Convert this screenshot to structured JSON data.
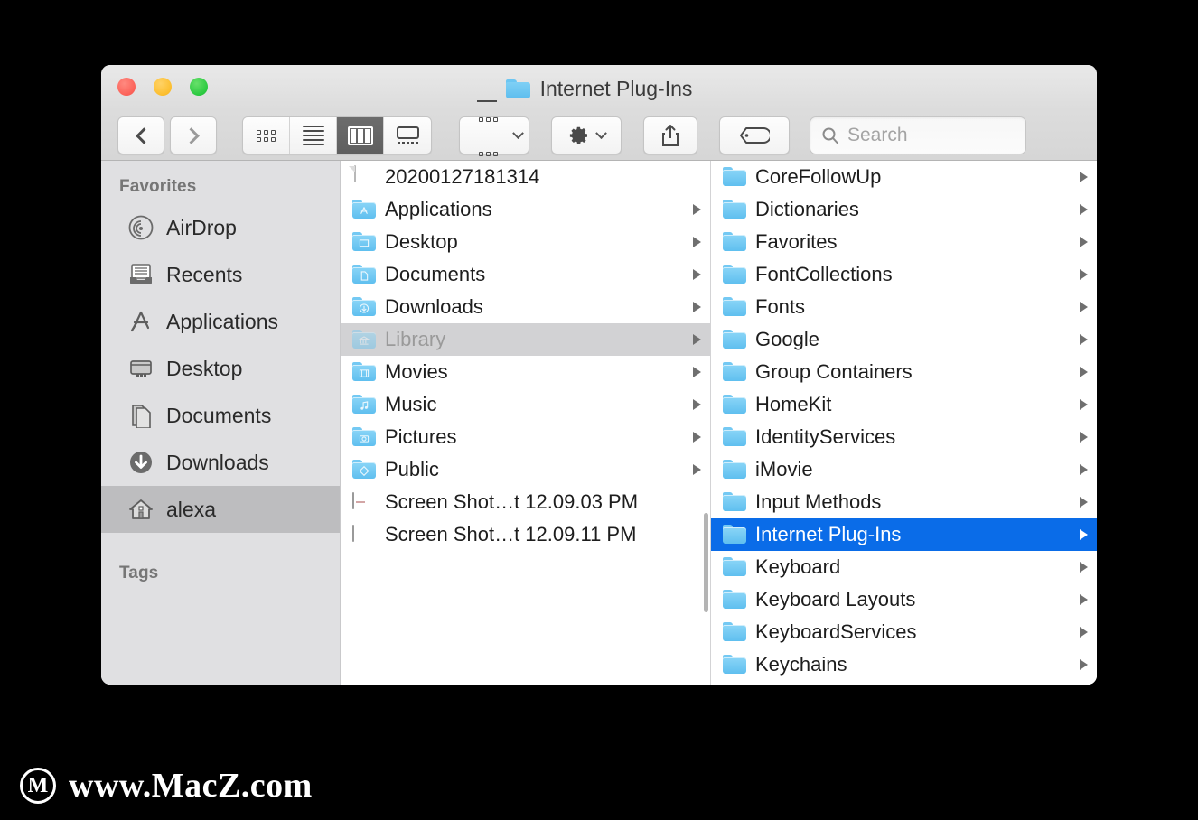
{
  "window": {
    "title": "Internet Plug-Ins",
    "title_icon": "folder-icon",
    "traffic_lights": [
      {
        "name": "close-button",
        "color": "#fb6158"
      },
      {
        "name": "minimize-button",
        "color": "#fcbe2e"
      },
      {
        "name": "maximize-button",
        "color": "#2bc940"
      }
    ]
  },
  "toolbar": {
    "back_label": "",
    "forward_label": "",
    "view_modes": [
      {
        "name": "icon-view",
        "icon": "grid-icon",
        "active": false
      },
      {
        "name": "list-view",
        "icon": "list-icon",
        "active": false
      },
      {
        "name": "column-view",
        "icon": "columns-icon",
        "active": true
      },
      {
        "name": "gallery-view",
        "icon": "coverflow-icon",
        "active": false
      }
    ],
    "arrange_label": "",
    "action_label": "",
    "share_label": "",
    "tags_label": ""
  },
  "search": {
    "placeholder": "Search",
    "value": "",
    "icon": "search-icon"
  },
  "sidebar": {
    "sections": [
      {
        "header": "Favorites",
        "items": [
          {
            "label": "AirDrop",
            "icon": "airdrop-icon",
            "selected": false
          },
          {
            "label": "Recents",
            "icon": "recents-icon",
            "selected": false
          },
          {
            "label": "Applications",
            "icon": "applications-icon",
            "selected": false
          },
          {
            "label": "Desktop",
            "icon": "desktop-icon",
            "selected": false
          },
          {
            "label": "Documents",
            "icon": "documents-icon",
            "selected": false
          },
          {
            "label": "Downloads",
            "icon": "downloads-icon",
            "selected": false
          },
          {
            "label": "alexa",
            "icon": "home-icon",
            "selected": true
          }
        ]
      },
      {
        "header": "Tags",
        "items": []
      }
    ]
  },
  "columns": [
    {
      "name": "column-home",
      "rows": [
        {
          "label": "20200127181314",
          "icon": "file-icon",
          "arrow": false,
          "state": "normal"
        },
        {
          "label": "Applications",
          "icon": "folder-apps-icon",
          "arrow": true,
          "state": "normal"
        },
        {
          "label": "Desktop",
          "icon": "folder-desktop-icon",
          "arrow": true,
          "state": "normal"
        },
        {
          "label": "Documents",
          "icon": "folder-documents-icon",
          "arrow": true,
          "state": "normal"
        },
        {
          "label": "Downloads",
          "icon": "folder-downloads-icon",
          "arrow": true,
          "state": "normal"
        },
        {
          "label": "Library",
          "icon": "folder-library-icon",
          "arrow": true,
          "state": "highlighted"
        },
        {
          "label": "Movies",
          "icon": "folder-movies-icon",
          "arrow": true,
          "state": "normal"
        },
        {
          "label": "Music",
          "icon": "folder-music-icon",
          "arrow": true,
          "state": "normal"
        },
        {
          "label": "Pictures",
          "icon": "folder-pictures-icon",
          "arrow": true,
          "state": "normal"
        },
        {
          "label": "Public",
          "icon": "folder-public-icon",
          "arrow": true,
          "state": "normal"
        },
        {
          "label": "Screen Shot…t 12.09.03 PM",
          "icon": "screenshot-icon",
          "arrow": false,
          "state": "normal"
        },
        {
          "label": "Screen Shot…t 12.09.11 PM",
          "icon": "screenshot-cols-icon",
          "arrow": false,
          "state": "normal"
        }
      ]
    },
    {
      "name": "column-library",
      "rows": [
        {
          "label": "CoreFollowUp",
          "icon": "folder-icon",
          "arrow": true,
          "state": "normal"
        },
        {
          "label": "Dictionaries",
          "icon": "folder-icon",
          "arrow": true,
          "state": "normal"
        },
        {
          "label": "Favorites",
          "icon": "folder-icon",
          "arrow": true,
          "state": "normal"
        },
        {
          "label": "FontCollections",
          "icon": "folder-icon",
          "arrow": true,
          "state": "normal"
        },
        {
          "label": "Fonts",
          "icon": "folder-icon",
          "arrow": true,
          "state": "normal"
        },
        {
          "label": "Google",
          "icon": "folder-icon",
          "arrow": true,
          "state": "normal"
        },
        {
          "label": "Group Containers",
          "icon": "folder-icon",
          "arrow": true,
          "state": "normal"
        },
        {
          "label": "HomeKit",
          "icon": "folder-icon",
          "arrow": true,
          "state": "normal"
        },
        {
          "label": "IdentityServices",
          "icon": "folder-icon",
          "arrow": true,
          "state": "normal"
        },
        {
          "label": "iMovie",
          "icon": "folder-icon",
          "arrow": true,
          "state": "normal"
        },
        {
          "label": "Input Methods",
          "icon": "folder-icon",
          "arrow": true,
          "state": "normal"
        },
        {
          "label": "Internet Plug-Ins",
          "icon": "folder-icon",
          "arrow": true,
          "state": "selected"
        },
        {
          "label": "Keyboard",
          "icon": "folder-icon",
          "arrow": true,
          "state": "normal"
        },
        {
          "label": "Keyboard Layouts",
          "icon": "folder-icon",
          "arrow": true,
          "state": "normal"
        },
        {
          "label": "KeyboardServices",
          "icon": "folder-icon",
          "arrow": true,
          "state": "normal"
        },
        {
          "label": "Keychains",
          "icon": "folder-icon",
          "arrow": true,
          "state": "normal"
        }
      ]
    }
  ],
  "watermark": {
    "logo_letter": "M",
    "text": "www.MacZ.com"
  },
  "colors": {
    "selection_blue": "#0a6ce8",
    "highlight_gray": "#d2d2d4",
    "sidebar_bg": "#e0e0e2",
    "folder_blue": "#5fbfef"
  }
}
